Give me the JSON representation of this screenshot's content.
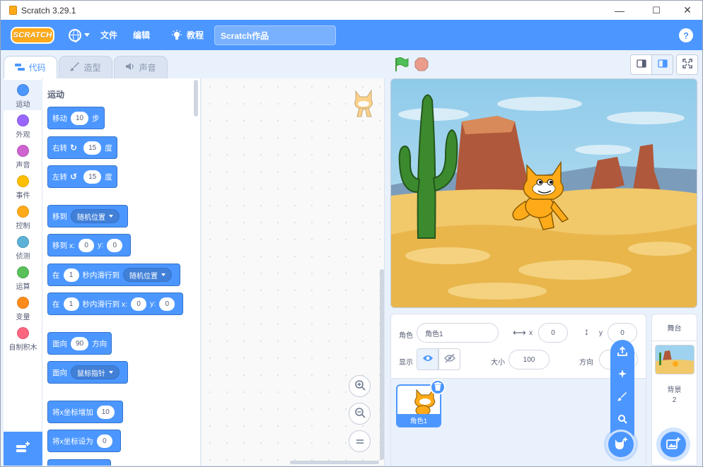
{
  "window": {
    "title": "Scratch 3.29.1",
    "minimize": "—",
    "maximize": "☐",
    "close": "✕"
  },
  "menubar": {
    "logo": "SCRATCH",
    "file": "文件",
    "edit": "编辑",
    "tutorials": "教程",
    "project_title": "Scratch作品",
    "help": "?"
  },
  "tabs": [
    {
      "label": "代码",
      "icon": "code-icon"
    },
    {
      "label": "造型",
      "icon": "brush-icon"
    },
    {
      "label": "声音",
      "icon": "speaker-icon"
    }
  ],
  "categories": [
    {
      "label": "运动",
      "color": "#4c97ff"
    },
    {
      "label": "外观",
      "color": "#9966ff"
    },
    {
      "label": "声音",
      "color": "#cf63cf"
    },
    {
      "label": "事件",
      "color": "#ffbf00"
    },
    {
      "label": "控制",
      "color": "#ffab19"
    },
    {
      "label": "侦测",
      "color": "#5cb1d6"
    },
    {
      "label": "运算",
      "color": "#59c059"
    },
    {
      "label": "变量",
      "color": "#ff8c1a"
    },
    {
      "label": "自制积木",
      "color": "#ff6680"
    }
  ],
  "palette": {
    "heading": "运动",
    "move": {
      "a": "移动",
      "v": "10",
      "b": "步"
    },
    "turn_right": {
      "a": "右转",
      "v": "15",
      "b": "度"
    },
    "turn_left": {
      "a": "左转",
      "v": "15",
      "b": "度"
    },
    "goto": {
      "a": "移到",
      "dd": "随机位置"
    },
    "goto_xy": {
      "a": "移到 x:",
      "x": "0",
      "yl": "y:",
      "y": "0"
    },
    "glide": {
      "a": "在",
      "v": "1",
      "b": "秒内滑行到",
      "dd": "随机位置"
    },
    "glide_xy": {
      "a": "在",
      "v": "1",
      "b": "秒内滑行到 x:",
      "x": "0",
      "yl": "y:",
      "y": "0"
    },
    "point_dir": {
      "a": "面向",
      "v": "90",
      "b": "方向"
    },
    "point_towards": {
      "a": "面向",
      "dd": "鼠标指针"
    },
    "change_x": {
      "a": "将x坐标增加",
      "v": "10"
    },
    "set_x": {
      "a": "将x坐标设为",
      "v": "0"
    }
  },
  "sprite_info": {
    "sprite_label": "角色",
    "sprite_name": "角色1",
    "x_label": "x",
    "x_value": "0",
    "y_label": "y",
    "y_value": "0",
    "show_label": "显示",
    "size_label": "大小",
    "size_value": "100",
    "direction_label": "方向"
  },
  "sprites": [
    {
      "name": "角色1"
    }
  ],
  "stage_panel": {
    "title": "舞台",
    "backdrops_label": "背景",
    "backdrops_count": "2"
  }
}
